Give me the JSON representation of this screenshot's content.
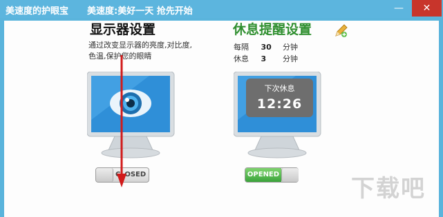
{
  "window": {
    "app_title": "美速度的护眼宝",
    "slogan": "美速度:美好一天 抢先开始",
    "minimize_glyph": "—",
    "close_glyph": "✕"
  },
  "display_panel": {
    "title": "显示器设置",
    "description": "通过改变显示器的亮度,对比度,色温,保护您的眼睛",
    "toggle_label": "CLOSED",
    "toggle_state": "off"
  },
  "rest_panel": {
    "title": "休息提醒设置",
    "interval_label": "每隔",
    "interval_value": "30",
    "interval_unit": "分钟",
    "rest_label": "休息",
    "rest_value": "3",
    "rest_unit": "分钟",
    "next_rest_label": "下次休息",
    "next_rest_time": "12:26",
    "toggle_label": "OPENED",
    "toggle_state": "on",
    "edit_icon": "pencil-icon"
  },
  "watermark": "下载吧",
  "colors": {
    "titlebar": "#5cb5de",
    "close_button": "#c8352b",
    "rest_title": "#2f8f2f",
    "toggle_on": "#3aa33a",
    "annotation_arrow": "#d11a1a"
  }
}
